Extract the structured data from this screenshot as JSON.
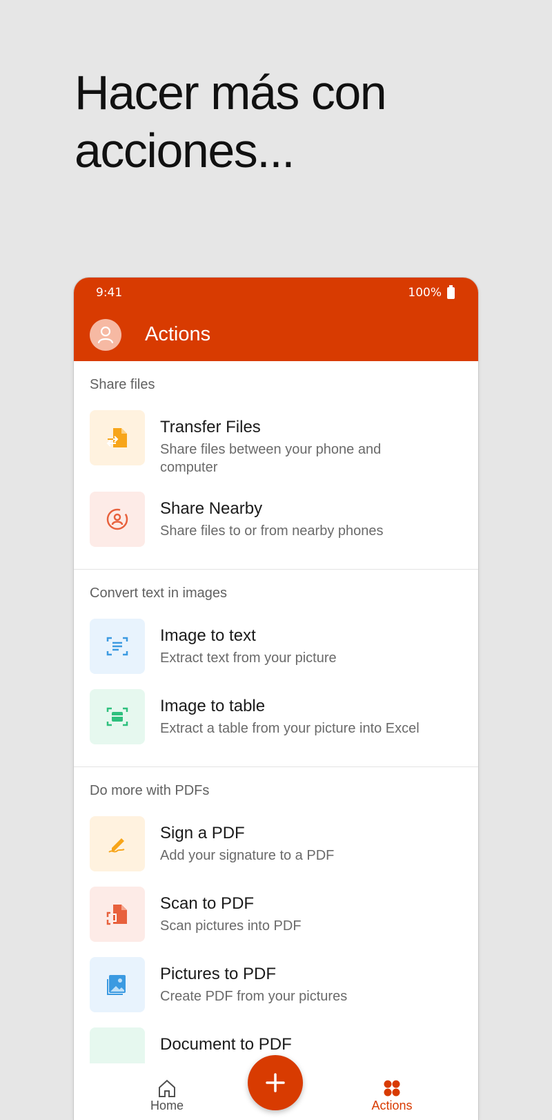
{
  "headline": "Hacer más con acciones...",
  "status": {
    "time": "9:41",
    "battery": "100%"
  },
  "appbar": {
    "title": "Actions"
  },
  "sections": [
    {
      "title": "Share files",
      "items": [
        {
          "title": "Transfer Files",
          "subtitle": "Share files between your phone and computer",
          "icon": "transfer-files-icon"
        },
        {
          "title": "Share Nearby",
          "subtitle": "Share files to or from nearby phones",
          "icon": "share-nearby-icon"
        }
      ]
    },
    {
      "title": "Convert text in images",
      "items": [
        {
          "title": "Image to text",
          "subtitle": "Extract text from your picture",
          "icon": "image-to-text-icon"
        },
        {
          "title": "Image to table",
          "subtitle": "Extract a table from your picture into Excel",
          "icon": "image-to-table-icon"
        }
      ]
    },
    {
      "title": "Do more with PDFs",
      "items": [
        {
          "title": "Sign a PDF",
          "subtitle": "Add your signature to a PDF",
          "icon": "sign-pdf-icon"
        },
        {
          "title": "Scan to PDF",
          "subtitle": "Scan pictures into PDF",
          "icon": "scan-pdf-icon"
        },
        {
          "title": "Pictures to PDF",
          "subtitle": "Create PDF from your pictures",
          "icon": "pictures-pdf-icon"
        },
        {
          "title": "Document to PDF",
          "subtitle": "",
          "icon": "document-pdf-icon"
        }
      ]
    }
  ],
  "bottom_nav": {
    "home_label": "Home",
    "actions_label": "Actions"
  },
  "colors": {
    "brand": "#d83b01",
    "background": "#e6e6e6"
  }
}
